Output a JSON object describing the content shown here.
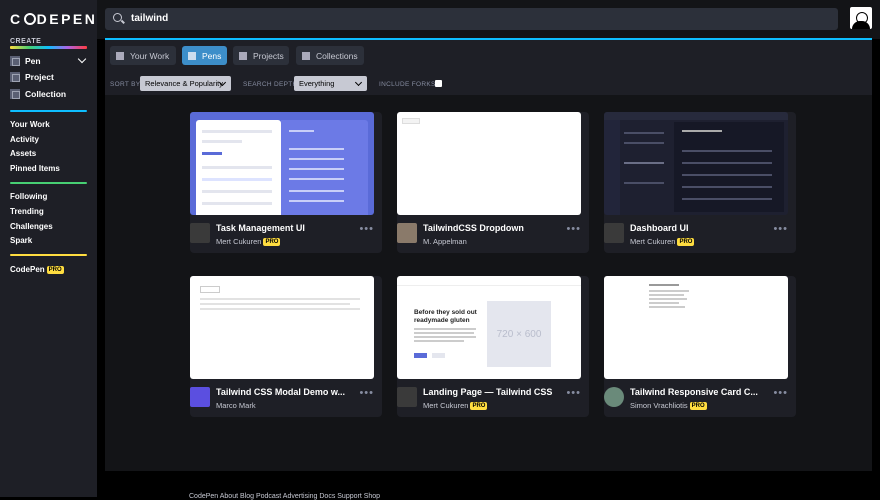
{
  "sidebar": {
    "logo": "CODEPEN",
    "create_label": "CREATE",
    "create_items": [
      {
        "label": "Pen",
        "icon": "pen-icon"
      },
      {
        "label": "Project",
        "icon": "project-icon"
      },
      {
        "label": "Collection",
        "icon": "collection-icon"
      }
    ],
    "nav_group_1": [
      "Your Work",
      "Activity",
      "Assets",
      "Pinned Items"
    ],
    "nav_group_2": [
      "Following",
      "Trending",
      "Challenges",
      "Spark"
    ],
    "codepen_pro": {
      "label": "CodePen",
      "badge": "PRO"
    },
    "separator_colors": [
      "#0ebeff",
      "#47cf73",
      "#ffdd40"
    ]
  },
  "search": {
    "value": "tailwind",
    "icon": "search-icon"
  },
  "tabs": [
    {
      "label": "Your Work",
      "icon": "user-icon",
      "active": false
    },
    {
      "label": "Pens",
      "icon": "pens-icon",
      "active": true
    },
    {
      "label": "Projects",
      "icon": "projects-icon",
      "active": false
    },
    {
      "label": "Collections",
      "icon": "collections-icon",
      "active": false
    }
  ],
  "filters": {
    "sort_by_label": "SORT BY",
    "sort_by_value": "Relevance & Popularity",
    "search_depth_label": "SEARCH DEPTH",
    "search_depth_value": "Everything",
    "include_forks_label": "INCLUDE FORKS?",
    "include_forks_checked": false
  },
  "cards": [
    {
      "title": "Task Management UI",
      "author": "Mert Cukuren",
      "pro": true,
      "badge": "PRO"
    },
    {
      "title": "TailwindCSS Dropdown",
      "author": "M. Appelman",
      "pro": false
    },
    {
      "title": "Dashboard UI",
      "author": "Mert Cukuren",
      "pro": true,
      "badge": "PRO"
    },
    {
      "title": "Tailwind CSS Modal Demo w...",
      "author": "Marco Mark",
      "pro": false
    },
    {
      "title": "Landing Page — Tailwind CSS",
      "author": "Mert Cukuren",
      "pro": true,
      "badge": "PRO",
      "thumb_heading": "Before they sold out readymade gluten",
      "thumb_placeholder": "720 × 600"
    },
    {
      "title": "Tailwind Responsive Card C...",
      "author": "Simon Vrachliotis",
      "pro": true,
      "badge": "PRO"
    }
  ],
  "colors": {
    "accent": "#0ebeff",
    "active_tab": "#3d8ec9",
    "pro": "#ffdd40"
  },
  "footer": {
    "text": "CodePen  About  Blog  Podcast  Advertising  Docs  Support  Shop"
  }
}
